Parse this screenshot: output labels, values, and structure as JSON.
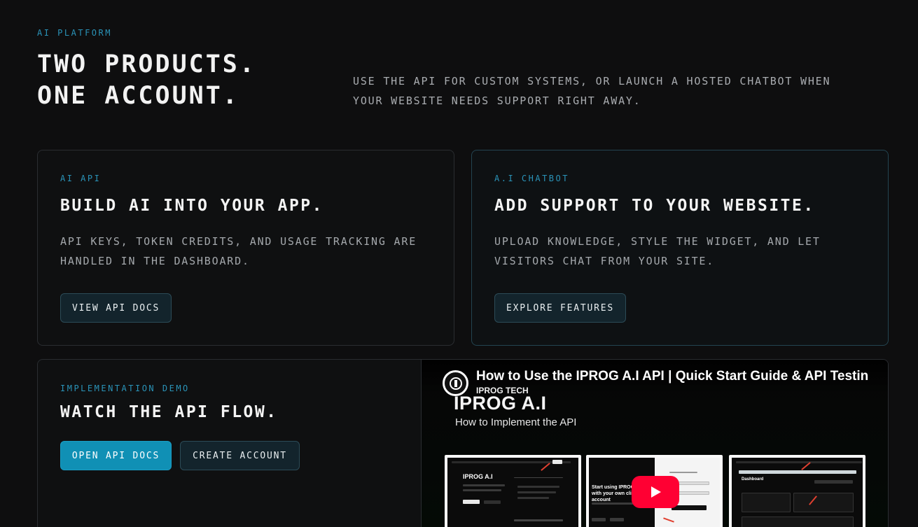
{
  "header": {
    "eyebrow": "AI PLATFORM",
    "title_line1": "TWO PRODUCTS.",
    "title_line2": "ONE ACCOUNT.",
    "subtitle": "USE THE API FOR CUSTOM SYSTEMS, OR LAUNCH A HOSTED CHATBOT WHEN YOUR WEBSITE NEEDS SUPPORT RIGHT AWAY."
  },
  "cards": [
    {
      "tag": "AI API",
      "title": "BUILD AI INTO YOUR APP.",
      "description": "API KEYS, TOKEN CREDITS, AND USAGE TRACKING ARE HANDLED IN THE DASHBOARD.",
      "button": "VIEW API DOCS"
    },
    {
      "tag": "A.I CHATBOT",
      "title": "ADD SUPPORT TO YOUR WEBSITE.",
      "description": "UPLOAD KNOWLEDGE, STYLE THE WIDGET, AND LET VISITORS CHAT FROM YOUR SITE.",
      "button": "EXPLORE FEATURES"
    }
  ],
  "demo": {
    "tag": "IMPLEMENTATION DEMO",
    "title": "WATCH THE API FLOW.",
    "primary_button": "OPEN API DOCS",
    "secondary_button": "CREATE ACCOUNT",
    "video": {
      "title": "How to Use the IPROG A.I API | Quick Start Guide & API Testin",
      "channel": "IPROG TECH",
      "brand": "IPROG A.I",
      "subtitle": "How to Implement the API",
      "thumb1_heading": "IPROG A.I",
      "thumb2_heading": "Start using IPROG A.I with your own client account",
      "thumb3_heading": "Dashboard",
      "play_icon": "play-icon"
    }
  },
  "colors": {
    "background": "#0e0e0f",
    "accent": "#2a93b8",
    "primary_button": "#1090b5",
    "youtube_red": "#ff0033"
  }
}
